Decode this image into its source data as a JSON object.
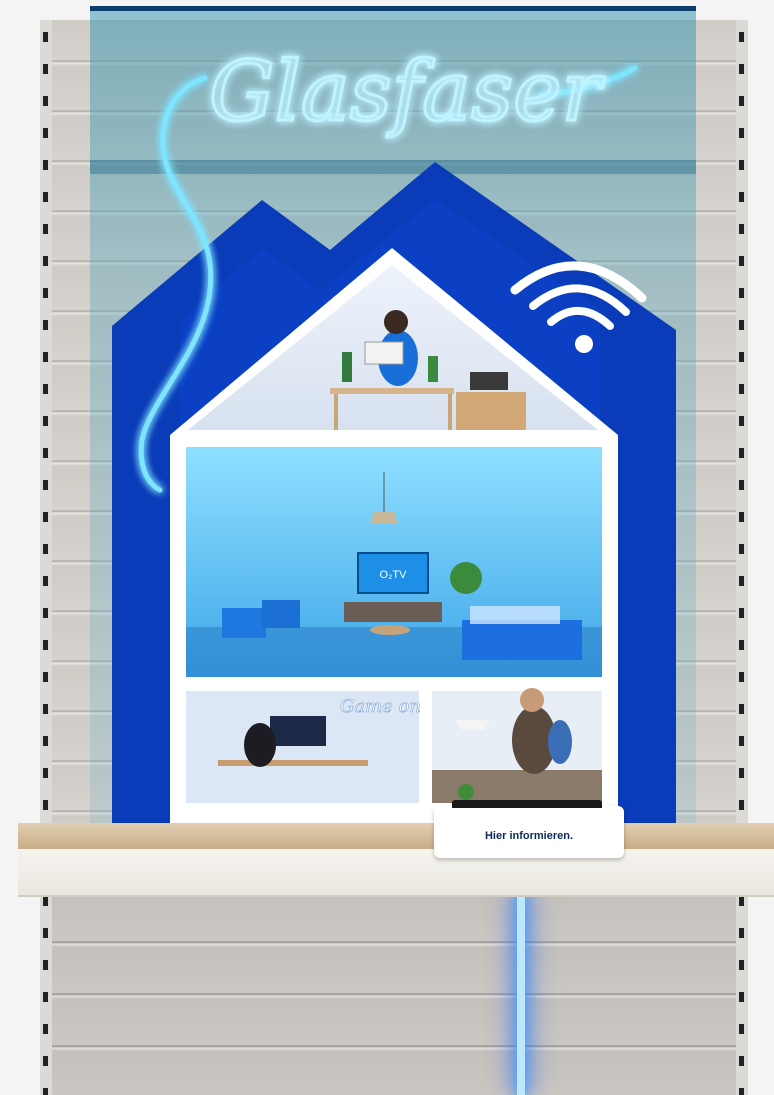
{
  "display": {
    "neon_sign": "Glasfaser",
    "tv_logo": "O₂TV",
    "game_sign": "Game on",
    "info_button": "Hier informieren."
  },
  "colors": {
    "house_blue": "#0a3bb8",
    "neon_glow": "#4fd0ff",
    "wall_gray": "#cfcbc6",
    "shelf_wood": "#d9c29e"
  },
  "icons": [
    "wifi-icon"
  ]
}
